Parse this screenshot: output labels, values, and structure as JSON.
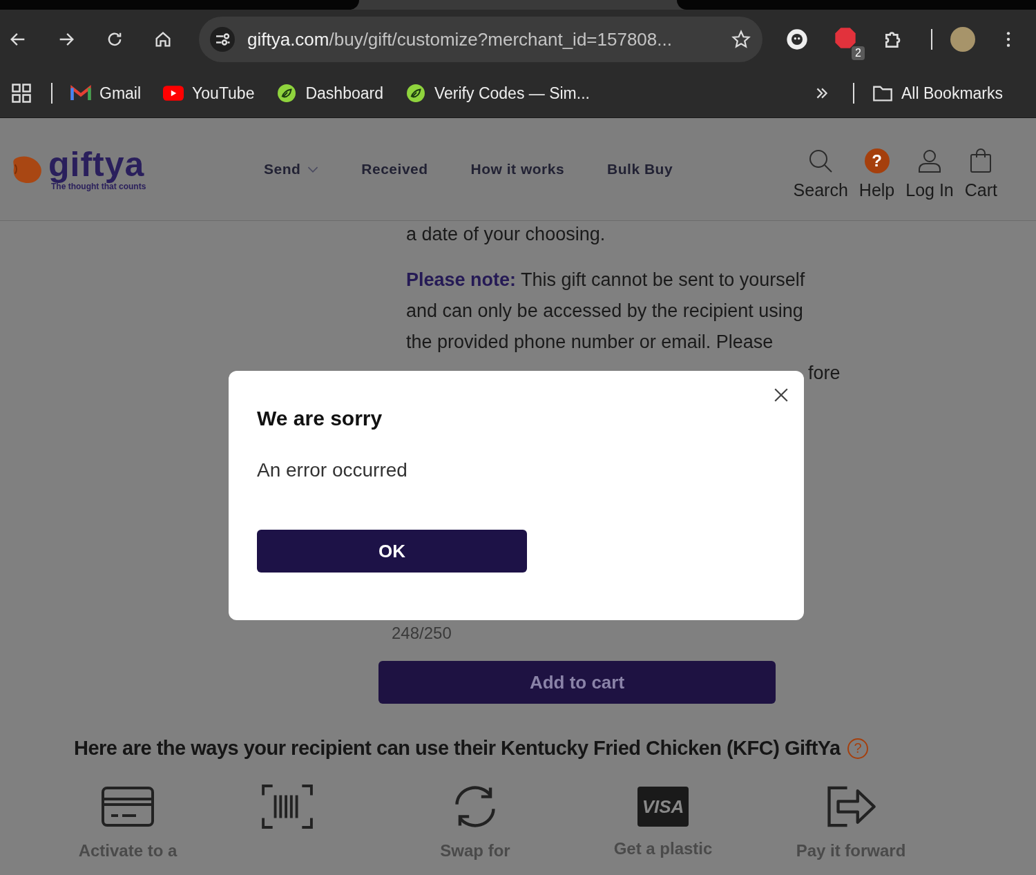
{
  "browser": {
    "url_host": "giftya.com",
    "url_path": "/buy/gift/customize?merchant_id=157808...",
    "extension_badge": "2"
  },
  "bookmarks": [
    {
      "label": "Gmail",
      "kind": "gmail"
    },
    {
      "label": "YouTube",
      "kind": "youtube"
    },
    {
      "label": "Dashboard",
      "kind": "leaf"
    },
    {
      "label": "Verify Codes — Sim...",
      "kind": "leaf"
    }
  ],
  "all_bookmarks": "All Bookmarks",
  "site": {
    "logo": "giftya",
    "tagline": "The thought that counts",
    "nav": [
      {
        "label": "Send",
        "dropdown": true
      },
      {
        "label": "Received",
        "dropdown": false
      },
      {
        "label": "How it works",
        "dropdown": false
      },
      {
        "label": "Bulk Buy",
        "dropdown": false
      }
    ],
    "help_glyph": "?",
    "actions": [
      {
        "label": "Search",
        "kind": "search"
      },
      {
        "label": "Help",
        "kind": "help"
      },
      {
        "label": "Log In",
        "kind": "user"
      },
      {
        "label": "Cart",
        "kind": "bag"
      }
    ]
  },
  "content": {
    "intro": "a date of your choosing.",
    "note_lines": [
      "**Please note:** This gift cannot be sent to yourself",
      "and can only be accessed by the recipient using",
      "the provided phone number or email. Please",
      "fore"
    ],
    "char_count": "248/250",
    "add_to_cart": "Add to cart",
    "ways_heading": "Here are the ways your recipient can use their Kentucky Fried Chicken (KFC) GiftYa",
    "ways_help": "?",
    "ways": [
      {
        "kind": "card",
        "label": "Activate to a"
      },
      {
        "kind": "barcode"
      },
      {
        "kind": "swap",
        "label": "Swap for"
      },
      {
        "kind": "visa",
        "label": "Get a plastic",
        "logo": "VISA"
      },
      {
        "kind": "forward",
        "label": "Pay it forward"
      }
    ]
  },
  "dialog": {
    "title": "We are sorry",
    "message": "An error occurred",
    "button": "OK"
  }
}
